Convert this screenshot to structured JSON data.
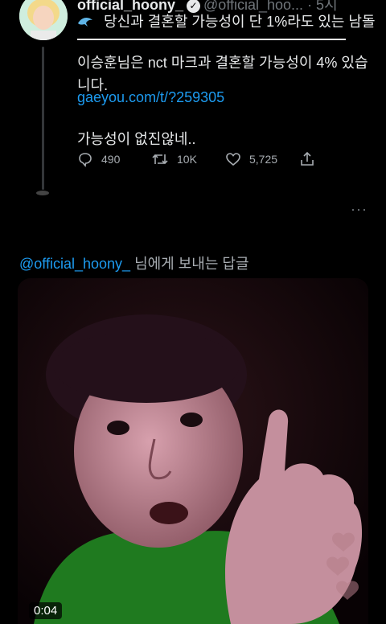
{
  "tweet": {
    "display_name": "official_hoony_",
    "handle": "@official_hoo...",
    "time": "· 5시",
    "headline_icon": "dolphin-icon",
    "headline": "당신과 결혼할 가능성이 단 1%라도 있는 남돌",
    "body": "이승훈님은 nct 마크과 결혼할 가능성이 4% 있습니다.",
    "link": "gaeyou.com/t/?259305",
    "comment": "가능성이 없진않네..",
    "actions": {
      "replies": "490",
      "retweets": "10K",
      "likes": "5,725"
    }
  },
  "reply_context": {
    "handle": "@official_hoony_",
    "suffix": "님에게 보내는 답글"
  },
  "video": {
    "duration": "0:04"
  },
  "more_label": "···",
  "colors": {
    "background": "#000000",
    "text": "#e7e9ea",
    "secondary": "#71767b",
    "link": "#1d9bf0"
  }
}
